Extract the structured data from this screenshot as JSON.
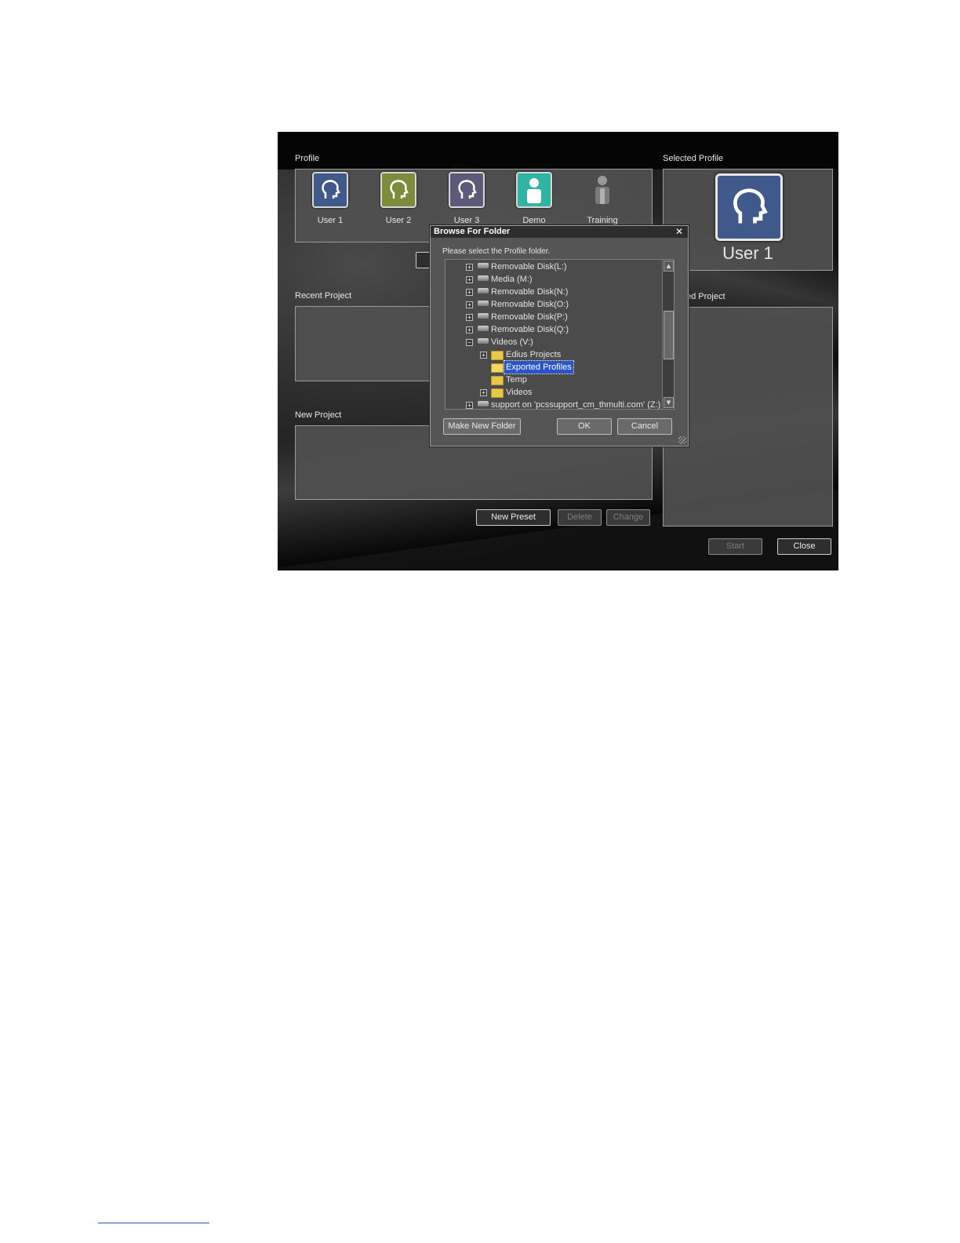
{
  "main_window": {
    "profile_label": "Profile",
    "selected_profile_label": "Selected Profile",
    "recent_project_label": "Recent Project",
    "new_project_label": "New Project",
    "right_project_label_partial": "ed Project",
    "profiles": [
      {
        "name": "User 1",
        "icon": "user-head-icon",
        "color": "#3f5a8a"
      },
      {
        "name": "User 2",
        "icon": "user-head-icon",
        "color": "#7d8c3a"
      },
      {
        "name": "User 3",
        "icon": "user-head-icon",
        "color": "#5b5a78"
      },
      {
        "name": "Demo",
        "icon": "person-icon",
        "color": "#2fb3a2"
      },
      {
        "name": "Training",
        "icon": "person-icon",
        "color": "#555555"
      }
    ],
    "selected_profile_name": "User 1",
    "buttons": {
      "new_preset": "New Preset",
      "delete": "Delete",
      "change": "Change",
      "start": "Start",
      "close": "Close"
    }
  },
  "dialog": {
    "title": "Browse For Folder",
    "instruction": "Please select the Profile folder.",
    "tree": [
      {
        "label": "Removable Disk(L:)",
        "type": "drive",
        "expander": "+",
        "level": 0
      },
      {
        "label": "Media (M:)",
        "type": "drive",
        "expander": "+",
        "level": 0
      },
      {
        "label": "Removable Disk(N:)",
        "type": "drive",
        "expander": "+",
        "level": 0
      },
      {
        "label": "Removable Disk(O:)",
        "type": "drive",
        "expander": "+",
        "level": 0
      },
      {
        "label": "Removable Disk(P:)",
        "type": "drive",
        "expander": "+",
        "level": 0
      },
      {
        "label": "Removable Disk(Q:)",
        "type": "drive",
        "expander": "+",
        "level": 0
      },
      {
        "label": "Videos (V:)",
        "type": "drive",
        "expander": "−",
        "level": 0
      },
      {
        "label": "Edius Projects",
        "type": "folder",
        "expander": "+",
        "level": 1
      },
      {
        "label": "Exported Profiles",
        "type": "folder",
        "expander": "",
        "level": 1,
        "selected": true
      },
      {
        "label": "Temp",
        "type": "folder",
        "expander": "",
        "level": 1
      },
      {
        "label": "Videos",
        "type": "folder",
        "expander": "+",
        "level": 1
      },
      {
        "label": "support on 'pcssupport_cm_thmulti.com' (Z:)",
        "type": "drive",
        "expander": "+",
        "level": 0
      }
    ],
    "buttons": {
      "make_new_folder": "Make New Folder",
      "ok": "OK",
      "cancel": "Cancel"
    }
  }
}
